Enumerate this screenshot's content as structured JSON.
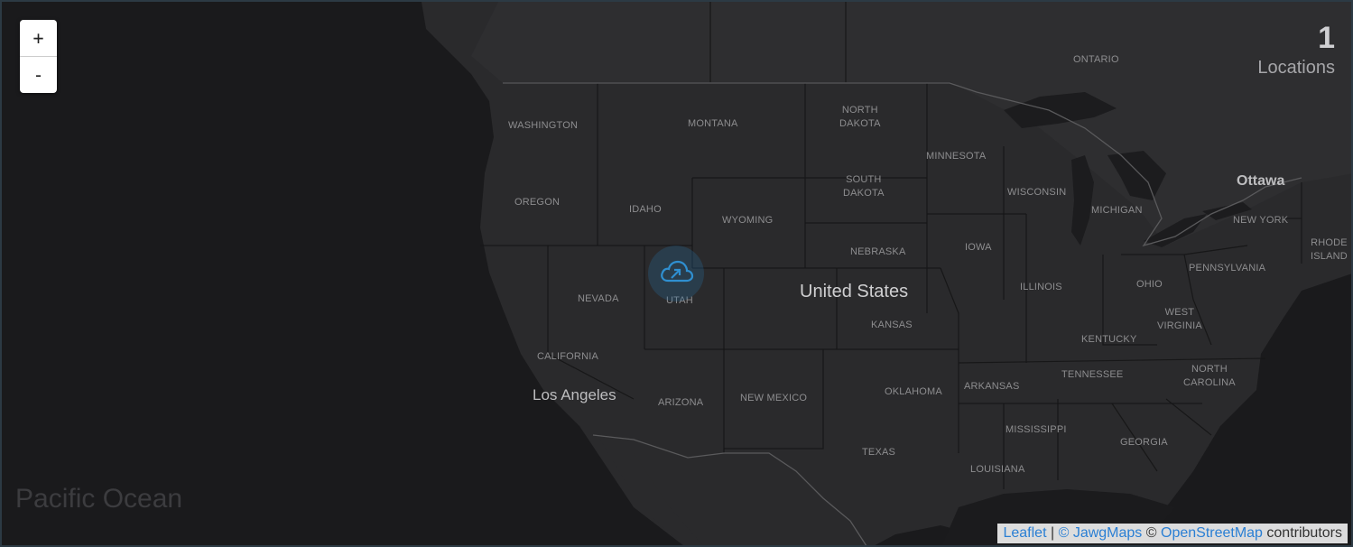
{
  "zoom": {
    "in_label": "+",
    "out_label": "-"
  },
  "counter": {
    "value": "1",
    "caption": "Locations"
  },
  "labels": {
    "ontario": "ONTARIO",
    "washington": "WASHINGTON",
    "montana": "MONTANA",
    "north_dakota": "NORTH\nDAKOTA",
    "minnesota": "MINNESOTA",
    "oregon": "OREGON",
    "idaho": "IDAHO",
    "wyoming": "WYOMING",
    "south_dakota": "SOUTH\nDAKOTA",
    "wisconsin": "WISCONSIN",
    "michigan": "MICHIGAN",
    "new_york": "NEW YORK",
    "nebraska": "NEBRASKA",
    "iowa": "IOWA",
    "nevada": "NEVADA",
    "utah": "UTAH",
    "illinois": "ILLINOIS",
    "ohio": "OHIO",
    "pennsylvania": "PENNSYLVANIA",
    "rhode_island": "RHODE\nISLAND",
    "kansas": "KANSAS",
    "west_virginia": "WEST\nVIRGINIA",
    "kentucky": "KENTUCKY",
    "california": "CALIFORNIA",
    "tennessee": "TENNESSEE",
    "north_carolina": "NORTH\nCAROLINA",
    "arizona": "ARIZONA",
    "new_mexico": "NEW MEXICO",
    "oklahoma": "OKLAHOMA",
    "arkansas": "ARKANSAS",
    "mississippi": "MISSISSIPPI",
    "georgia": "GEORGIA",
    "texas": "TEXAS",
    "louisiana": "LOUISIANA"
  },
  "places": {
    "country": "United States",
    "los_angeles": "Los Angeles",
    "ottawa": "Ottawa",
    "ocean": "Pacific Ocean"
  },
  "marker": {
    "icon": "cloud-upload-icon",
    "color": "#2f8fd0"
  },
  "attribution": {
    "leaflet": "Leaflet",
    "sep": "|",
    "jawg": "© JawgMaps",
    "copy": "©",
    "osm": "OpenStreetMap",
    "contributors": "contributors"
  }
}
